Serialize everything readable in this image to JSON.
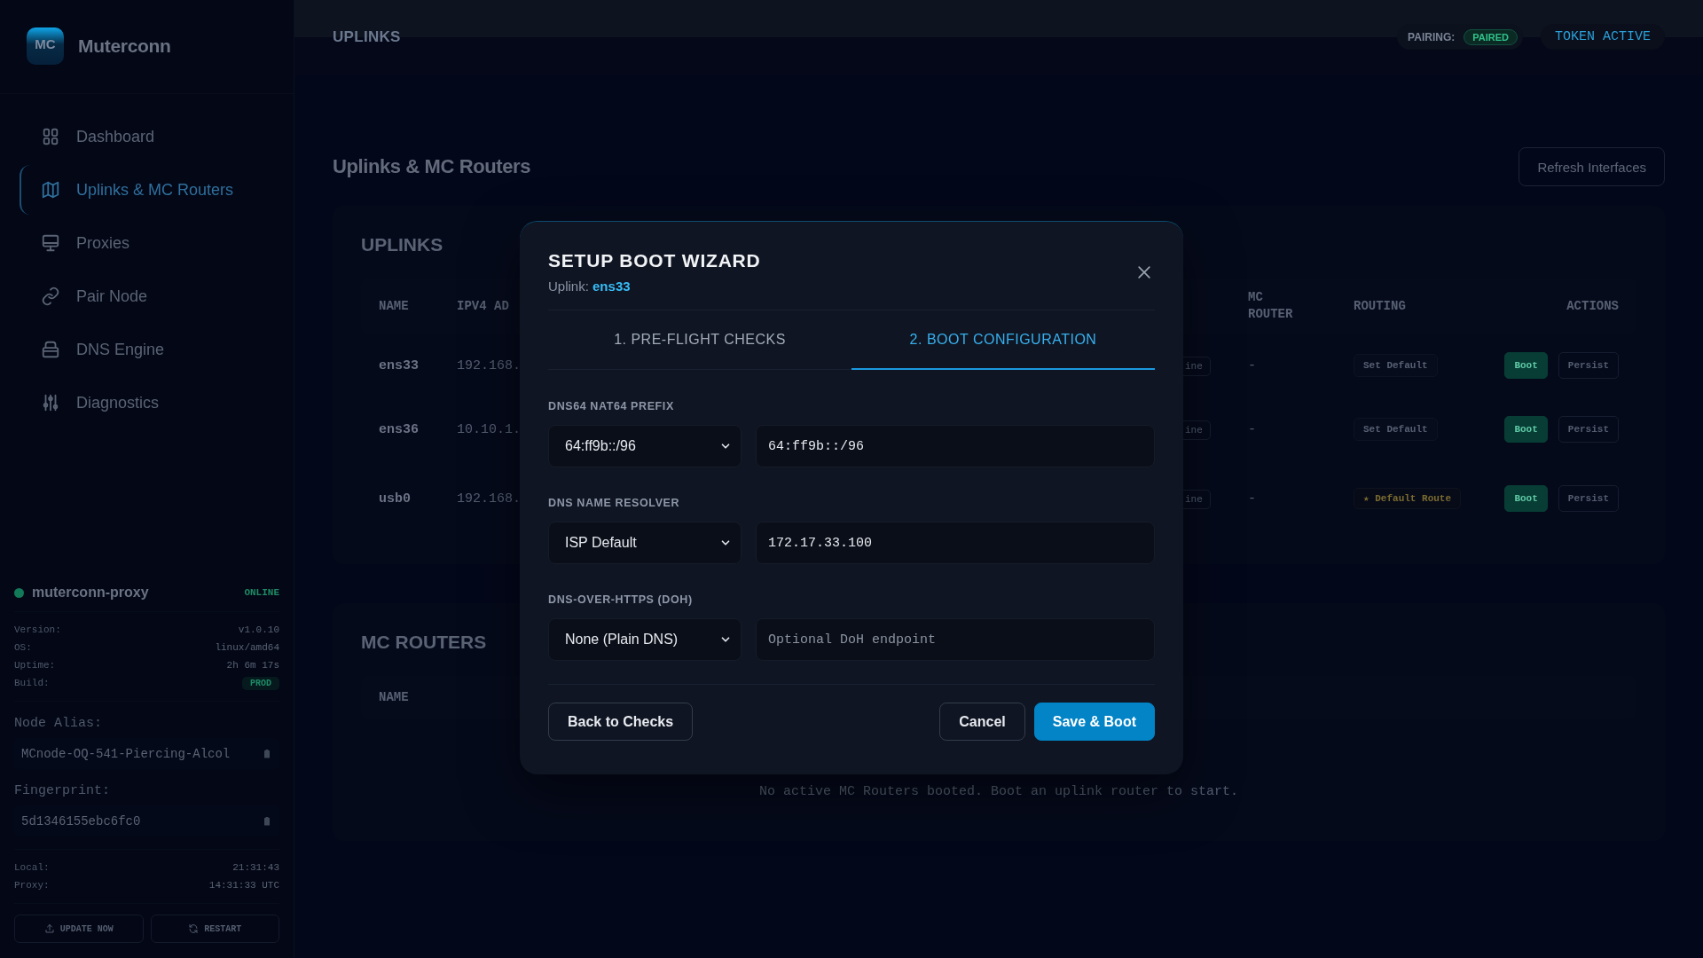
{
  "app": {
    "logo": "MC",
    "name": "Muterconn"
  },
  "sidebar": {
    "items": [
      {
        "label": "Dashboard",
        "selected": false
      },
      {
        "label": "Uplinks & MC Routers",
        "selected": true
      },
      {
        "label": "Proxies",
        "selected": false
      },
      {
        "label": "Pair Node",
        "selected": false
      },
      {
        "label": "DNS Engine",
        "selected": false
      },
      {
        "label": "Diagnostics",
        "selected": false
      }
    ]
  },
  "node": {
    "name": "muterconn-proxy",
    "online": true,
    "status": "ONLINE",
    "details": [
      {
        "label": "Version:",
        "value": "v1.0.10",
        "kind": "text"
      },
      {
        "label": "OS:",
        "value": "linux/amd64",
        "kind": "text"
      },
      {
        "label": "Uptime:",
        "value": "2h 6m 17s",
        "kind": "text"
      },
      {
        "label": "Build:",
        "value": "PROD",
        "kind": "badge"
      }
    ],
    "alias_label": "Node Alias:",
    "alias": "MCnode-OQ-541-Piercing-Alcol",
    "fingerprint_label": "Fingerprint:",
    "fingerprint": "5d1346155ebc6fc0",
    "clock": [
      {
        "label": "Local:",
        "value": "21:31:43"
      },
      {
        "label": "Proxy:",
        "value": "14:31:33 UTC"
      }
    ],
    "actions": [
      "UPDATE NOW",
      "RESTART"
    ]
  },
  "topbar": {
    "section": "UPLINKS",
    "pairing_label": "PAIRING:",
    "pairing_status": "PAIRED",
    "token": "TOKEN ACTIVE"
  },
  "page": {
    "title": "Uplinks & MC Routers",
    "refresh_button": "Refresh Interfaces"
  },
  "uplinks": {
    "title": "UPLINKS",
    "columns": [
      "NAME",
      "IPV4 AD",
      "",
      "MC\nROUTER",
      "ROUTING",
      "ACTIONS"
    ],
    "rows": [
      {
        "name": "ens33",
        "ipv4": "192.168.",
        "status": "ine",
        "mc_router": "-",
        "routing": {
          "kind": "button",
          "label": "Set Default"
        },
        "actions": [
          "Boot",
          "Persist"
        ]
      },
      {
        "name": "ens36",
        "ipv4": "10.10.1.",
        "status": "ine",
        "mc_router": "-",
        "routing": {
          "kind": "button",
          "label": "Set Default"
        },
        "actions": [
          "Boot",
          "Persist"
        ]
      },
      {
        "name": "usb0",
        "ipv4": "192.168.",
        "status": "ine",
        "mc_router": "-",
        "routing": {
          "kind": "default",
          "label": "★ Default Route"
        },
        "actions": [
          "Boot",
          "Persist"
        ]
      }
    ]
  },
  "mc_routers": {
    "title": "MC ROUTERS",
    "columns": [
      "NAME"
    ],
    "empty": "No active MC Routers booted. Boot an uplink router to start."
  },
  "modal": {
    "title": "SETUP BOOT WIZARD",
    "subtitle_label": "Uplink:",
    "subtitle_value": "ens33",
    "tabs": [
      {
        "label": "1. PRE-FLIGHT CHECKS",
        "selected": false
      },
      {
        "label": "2. BOOT CONFIGURATION",
        "selected": true
      }
    ],
    "fields": [
      {
        "label": "DNS64 NAT64 PREFIX",
        "select": "64:ff9b::/96",
        "value": "64:ff9b::/96"
      },
      {
        "label": "DNS NAME RESOLVER",
        "select": "ISP Default",
        "value": "172.17.33.100"
      },
      {
        "label": "DNS-OVER-HTTPS (DOH)",
        "select": "None (Plain DNS)",
        "placeholder": "Optional DoH endpoint"
      }
    ],
    "back_button": "Back to Checks",
    "cancel_button": "Cancel",
    "save_button": "Save & Boot"
  }
}
